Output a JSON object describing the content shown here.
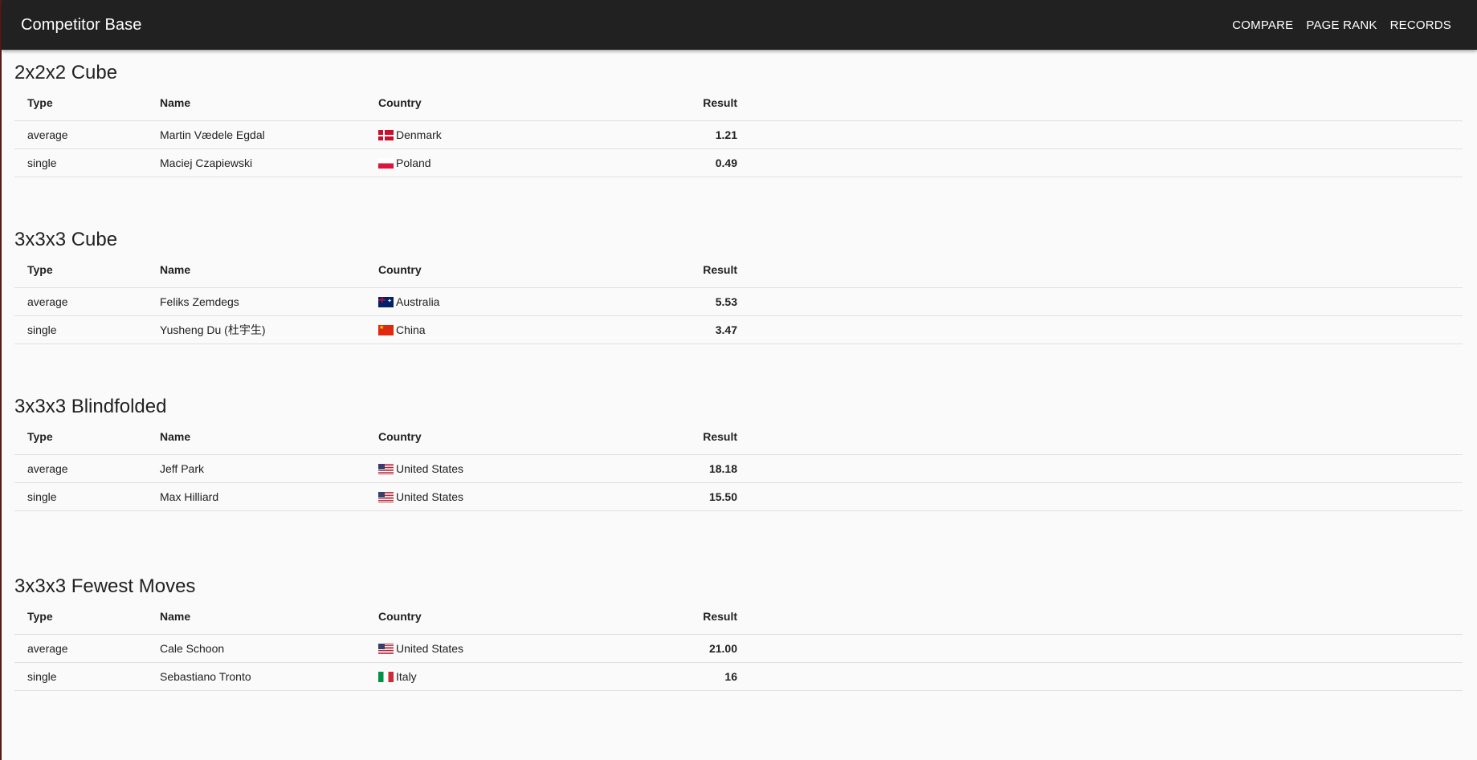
{
  "app": {
    "title": "Competitor Base"
  },
  "nav": {
    "compare": "COMPARE",
    "page_rank": "PAGE RANK",
    "records": "RECORDS"
  },
  "columns": {
    "type": "Type",
    "name": "Name",
    "country": "Country",
    "result": "Result"
  },
  "sections": [
    {
      "title": "2x2x2 Cube",
      "rows": [
        {
          "type": "average",
          "name": "Martin Vædele Egdal",
          "country": "Denmark",
          "flag": "dk",
          "result": "1.21"
        },
        {
          "type": "single",
          "name": "Maciej Czapiewski",
          "country": "Poland",
          "flag": "pl",
          "result": "0.49"
        }
      ]
    },
    {
      "title": "3x3x3 Cube",
      "rows": [
        {
          "type": "average",
          "name": "Feliks Zemdegs",
          "country": "Australia",
          "flag": "au",
          "result": "5.53"
        },
        {
          "type": "single",
          "name": "Yusheng Du (杜宇生)",
          "country": "China",
          "flag": "cn",
          "result": "3.47"
        }
      ]
    },
    {
      "title": "3x3x3 Blindfolded",
      "rows": [
        {
          "type": "average",
          "name": "Jeff Park",
          "country": "United States",
          "flag": "us",
          "result": "18.18"
        },
        {
          "type": "single",
          "name": "Max Hilliard",
          "country": "United States",
          "flag": "us",
          "result": "15.50"
        }
      ]
    },
    {
      "title": "3x3x3 Fewest Moves",
      "rows": [
        {
          "type": "average",
          "name": "Cale Schoon",
          "country": "United States",
          "flag": "us",
          "result": "21.00"
        },
        {
          "type": "single",
          "name": "Sebastiano Tronto",
          "country": "Italy",
          "flag": "it",
          "result": "16"
        }
      ]
    }
  ]
}
